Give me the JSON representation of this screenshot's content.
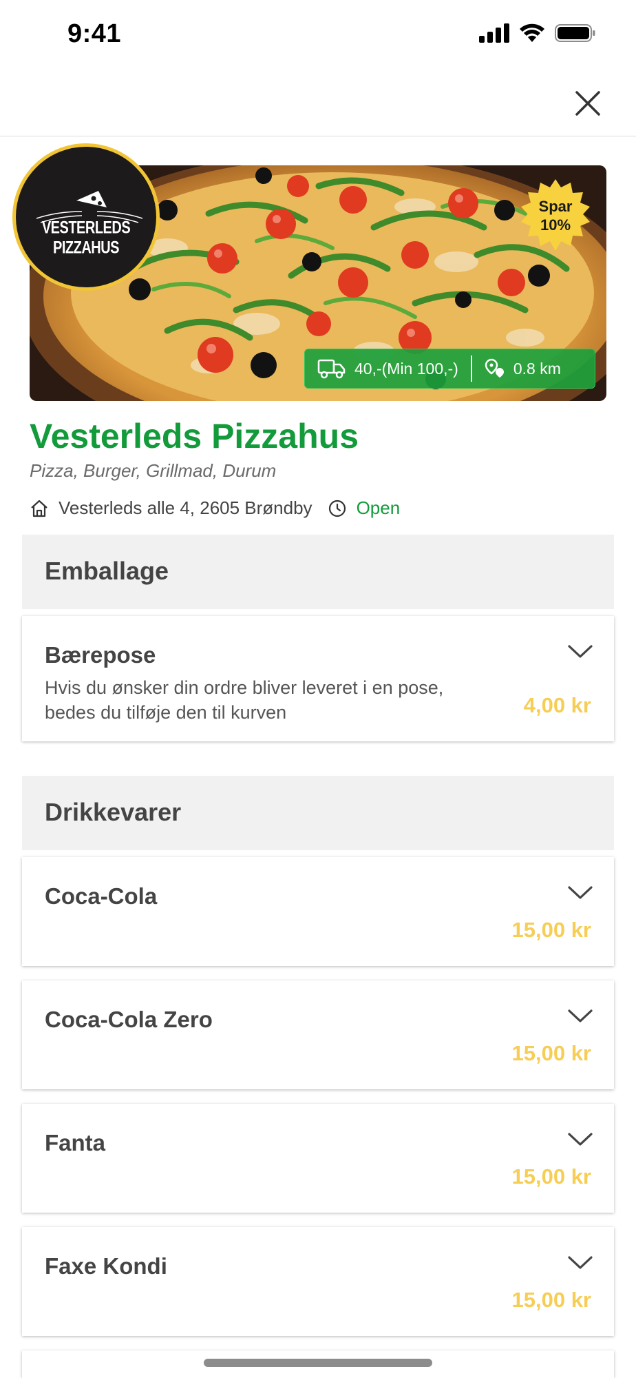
{
  "status_bar": {
    "time": "9:41"
  },
  "header": {
    "close_icon": "close-icon"
  },
  "restaurant": {
    "logo_text": "VESTERLEDS PIZZAHUS",
    "discount_badge": {
      "line1": "Spar",
      "line2": "10%"
    },
    "delivery_fee": "40,-(Min 100,-)",
    "distance": "0.8 km",
    "name": "Vesterleds Pizzahus",
    "categories": "Pizza, Burger, Grillmad, Durum",
    "address": "Vesterleds alle 4, 2605 Brøndby",
    "status": "Open"
  },
  "sections": [
    {
      "title": "Emballage",
      "items": [
        {
          "name": "Bærepose",
          "description": "Hvis du ønsker din ordre bliver leveret i en pose, bedes du tilføje den til kurven",
          "price": "4,00 kr"
        }
      ]
    },
    {
      "title": "Drikkevarer",
      "items": [
        {
          "name": "Coca-Cola",
          "price": "15,00 kr"
        },
        {
          "name": "Coca-Cola Zero",
          "price": "15,00 kr"
        },
        {
          "name": "Fanta",
          "price": "15,00 kr"
        },
        {
          "name": "Faxe Kondi",
          "price": "15,00 kr"
        }
      ]
    }
  ],
  "colors": {
    "brand_green": "#139b3b",
    "price_yellow": "#f6cd55",
    "logo_ring": "#f2c537"
  }
}
